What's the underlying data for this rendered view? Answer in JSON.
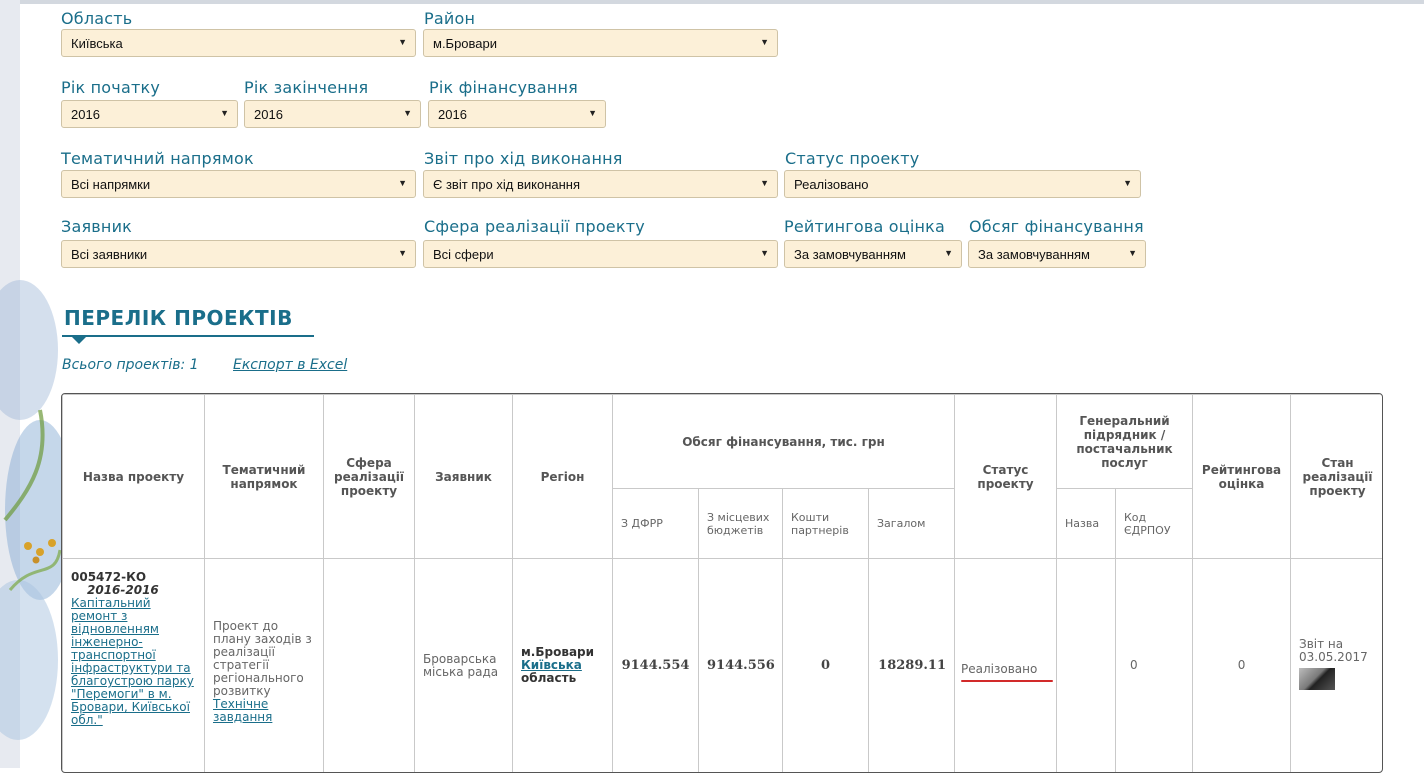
{
  "filters": {
    "oblast": {
      "label": "Область",
      "value": "Київська"
    },
    "rayon": {
      "label": "Район",
      "value": "м.Бровари"
    },
    "start_year": {
      "label": "Рік початку",
      "value": "2016"
    },
    "end_year": {
      "label": "Рік закінчення",
      "value": "2016"
    },
    "fin_year": {
      "label": "Рік фінансування",
      "value": "2016"
    },
    "direction": {
      "label": "Тематичний напрямок",
      "value": "Всі напрямки"
    },
    "report": {
      "label": "Звіт про хід виконання",
      "value": "Є звіт про хід виконання"
    },
    "status": {
      "label": "Статус проекту",
      "value": "Реалізовано"
    },
    "applicant": {
      "label": "Заявник",
      "value": "Всі заявники"
    },
    "sphere": {
      "label": "Сфера реалізації проекту",
      "value": "Всі сфери"
    },
    "rating": {
      "label": "Рейтингова оцінка",
      "value": "За замовчуванням"
    },
    "volume": {
      "label": "Обсяг фінансування",
      "value": "За замовчуванням"
    }
  },
  "list": {
    "title": "ПЕРЕЛІК ПРОЕКТІВ",
    "total": "Всього проектів: 1",
    "export": "Експорт в Excel"
  },
  "table": {
    "h_name": "Назва проекту",
    "h_direction": "Тематичний напрямок",
    "h_sphere": "Сфера реалізації проекту",
    "h_applicant": "Заявник",
    "h_region": "Регіон",
    "h_funding": "Обсяг фінансування, тис. грн",
    "h_dfrr": "З ДФРР",
    "h_local": "З місцевих бюджетів",
    "h_partners": "Кошти партнерів",
    "h_total": "Загалом",
    "h_status": "Статус проекту",
    "h_contractor": "Генеральний підрядник / постачальник послуг",
    "h_c_name": "Назва",
    "h_c_code": "Код ЄДРПОУ",
    "h_rating": "Рейтингова оцінка",
    "h_state": "Стан реалізації проекту",
    "row": {
      "code": "005472-КО",
      "years": "2016-2016",
      "name": "Капітальний ремонт з відновленням інженерно-транспортної інфраструктури та благоустрою парку \"Перемоги\" в м. Бровари, Київської обл.\"",
      "direction": "Проект до плану заходів з реалізації стратегії регіонального розвитку",
      "tech_task": "Технічне завдання",
      "sphere": "",
      "applicant": "Броварська міська рада",
      "region_city": "м.Бровари",
      "region_oblast": "Київська",
      "region_oblast_suffix": "область",
      "dfrr": "9144.554",
      "local": "9144.556",
      "partners": "0",
      "total": "18289.11",
      "status": "Реалізовано",
      "contractor_name": "",
      "contractor_code": "0",
      "rating": "0",
      "state": "Звіт на 03.05.2017"
    }
  }
}
